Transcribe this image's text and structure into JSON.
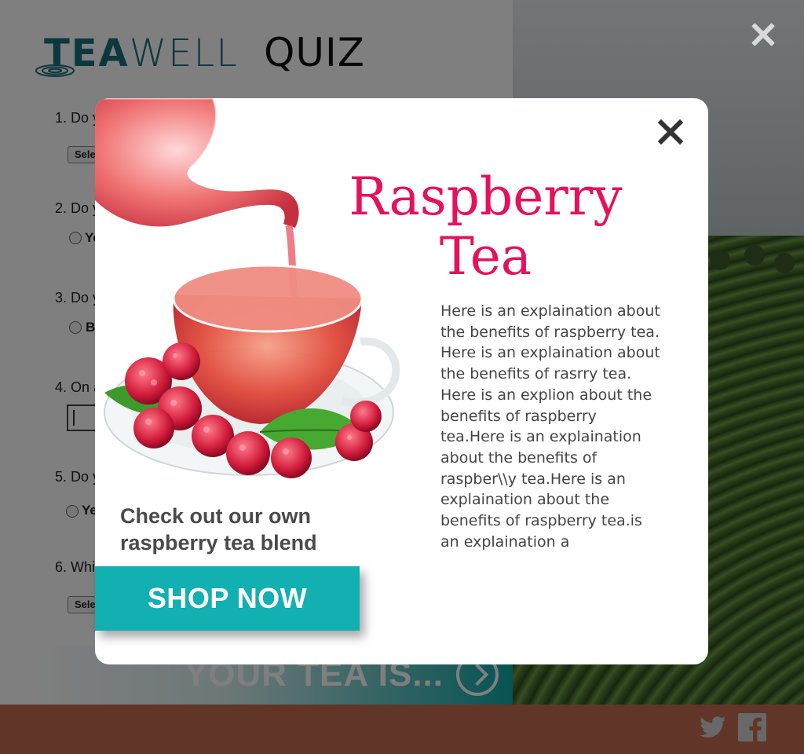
{
  "app": {
    "logo_text_bold": "TEA",
    "logo_text_light": "WELL",
    "title": "QUIZ"
  },
  "quiz": {
    "questions": [
      {
        "number_label": "1. Do y",
        "control": "select",
        "select_value": "Sele"
      },
      {
        "number_label": "2. Do y",
        "control": "radio",
        "option_label": "Ye"
      },
      {
        "number_label": "3. Do y",
        "control": "radio",
        "option_label": "B"
      },
      {
        "number_label": "4. On a",
        "control": "text"
      },
      {
        "number_label": "5. Do y",
        "control": "radio",
        "option_label": "Ye"
      },
      {
        "number_label": "6. Whi",
        "control": "select",
        "select_value": "Sele"
      }
    ],
    "result_label": "YOUR TEA IS..."
  },
  "modal": {
    "title_line1": "Raspberry",
    "title_line2": "Tea",
    "body": "Here is an explaination about the benefits of raspberry tea. Here is an explaination about the benefits of rasrry tea. Here is an explion about the benefits of raspberry tea.Here is an explaination about the benefits of raspber\\\\y tea.Here is an explaination about the benefits of raspberry tea.is an explaination a",
    "cta_line1": "Check out our own",
    "cta_line2": "raspberry tea blend",
    "shop_button": "SHOP NOW"
  },
  "footer": {
    "social_icons": [
      "twitter-icon",
      "facebook-icon"
    ]
  },
  "colors": {
    "brand_teal": "#12b0b0",
    "title_pink": "#e6115c",
    "footer": "#c26d50",
    "logo_teal": "#1a6f7c"
  }
}
